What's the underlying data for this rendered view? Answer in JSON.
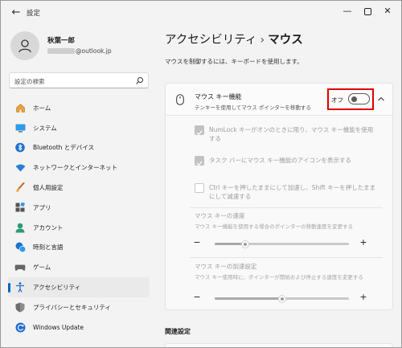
{
  "window": {
    "title": "設定",
    "back_icon": "arrow-left-icon",
    "controls": [
      "minimize-icon",
      "maximize-icon",
      "close-icon"
    ]
  },
  "user": {
    "name": "秋葉一郎",
    "email_visible": "@outlook.jp"
  },
  "search": {
    "placeholder": "設定の検索"
  },
  "nav": [
    {
      "label": "ホーム",
      "icon": "home-icon",
      "selected": false
    },
    {
      "label": "システム",
      "icon": "monitor-icon",
      "selected": false
    },
    {
      "label": "Bluetooth とデバイス",
      "icon": "bluetooth-icon",
      "selected": false
    },
    {
      "label": "ネットワークとインターネット",
      "icon": "wifi-icon",
      "selected": false
    },
    {
      "label": "個人用設定",
      "icon": "brush-icon",
      "selected": false
    },
    {
      "label": "アプリ",
      "icon": "apps-icon",
      "selected": false
    },
    {
      "label": "アカウント",
      "icon": "account-icon",
      "selected": false
    },
    {
      "label": "時刻と言語",
      "icon": "clock-globe-icon",
      "selected": false
    },
    {
      "label": "ゲーム",
      "icon": "gamepad-icon",
      "selected": false
    },
    {
      "label": "アクセシビリティ",
      "icon": "accessibility-icon",
      "selected": true
    },
    {
      "label": "プライバシーとセキュリティ",
      "icon": "shield-icon",
      "selected": false
    },
    {
      "label": "Windows Update",
      "icon": "update-icon",
      "selected": false
    }
  ],
  "breadcrumb": {
    "parent": "アクセシビリティ",
    "separator": "›",
    "current": "マウス"
  },
  "page_description": "マウスを制御するには、キーボードを使用します。",
  "mouse_keys": {
    "title": "マウス キー機能",
    "subtitle": "テンキーを使用してマウス ポインターを移動する",
    "toggle_label": "オフ",
    "toggle_on": false,
    "expanded": true
  },
  "options": [
    {
      "label": "NumLock キーがオンのときに限り、マウス キー機能を使用する",
      "checked": true
    },
    {
      "label": "タスク バーにマウス キー機能のアイコンを表示する",
      "checked": true
    },
    {
      "label": "Ctrl キーを押したままにして加速し、Shift キーを押したままにして減速する",
      "checked": false
    }
  ],
  "sliders": [
    {
      "title": "マウス キーの速度",
      "subtitle": "マウス キー機能を使用する場合のポインターの移動速度を変更する",
      "minus": "−",
      "plus": "+",
      "value_fraction": 0.23
    },
    {
      "title": "マウス キーの加速設定",
      "subtitle": "マウス キー使用時に、ポインターが開始および停止する速度を変更する",
      "minus": "−",
      "plus": "+",
      "value_fraction": 0.5
    }
  ],
  "related_settings": "関連設定",
  "colors": {
    "accent": "#0067c0",
    "highlight": "#e00000"
  }
}
